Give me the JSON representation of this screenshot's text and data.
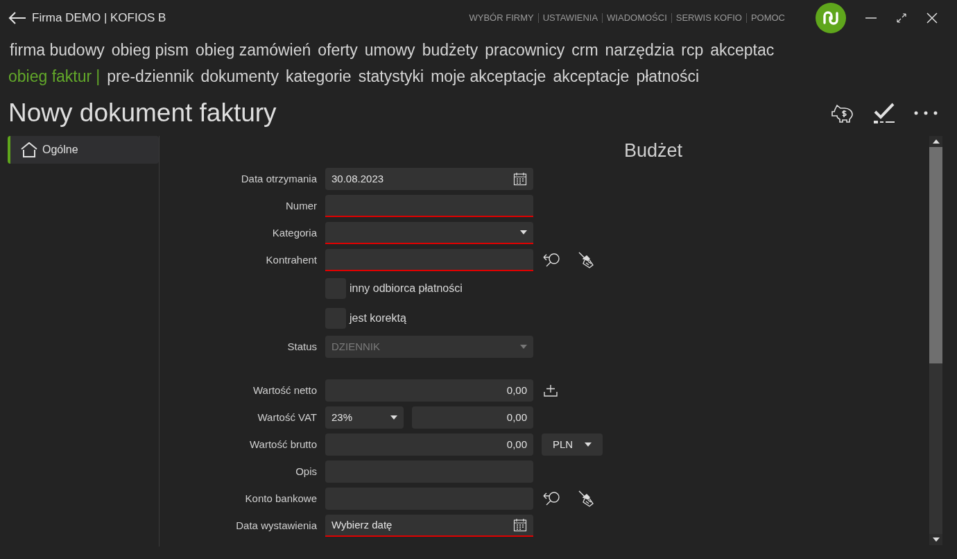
{
  "window": {
    "title": "Firma DEMO | KOFIOS B"
  },
  "top_links": [
    "WYBÓR FIRMY",
    "USTAWIENIA",
    "WIADOMOŚCI",
    "SERWIS KOFIO",
    "POMOC"
  ],
  "main_menu": [
    {
      "label": "firma budowy",
      "selected": false
    },
    {
      "label": "obieg pism",
      "selected": false
    },
    {
      "label": "obieg zamówień",
      "selected": false
    },
    {
      "label": "oferty",
      "selected": false
    },
    {
      "label": "umowy",
      "selected": false
    },
    {
      "label": "budżety",
      "selected": false
    },
    {
      "label": "pracownicy",
      "selected": false
    },
    {
      "label": "crm",
      "selected": false
    },
    {
      "label": "narzędzia",
      "selected": false
    },
    {
      "label": "rcp",
      "selected": false
    },
    {
      "label": "akceptac",
      "selected": false
    }
  ],
  "sub_menu": {
    "separator": "|",
    "items": [
      {
        "label": "obieg faktur",
        "selected": true
      },
      {
        "label": "pre-dziennik",
        "selected": false
      },
      {
        "label": "dokumenty",
        "selected": false
      },
      {
        "label": "kategorie",
        "selected": false
      },
      {
        "label": "statystyki",
        "selected": false
      },
      {
        "label": "moje akceptacje",
        "selected": false
      },
      {
        "label": "akceptacje",
        "selected": false
      },
      {
        "label": "płatności",
        "selected": false
      }
    ]
  },
  "page_title": "Nowy dokument faktury",
  "sidebar": {
    "items": [
      {
        "label": "Ogólne",
        "selected": true
      }
    ]
  },
  "budget_heading": "Budżet",
  "sections": [
    {
      "fields": [
        {
          "kind": "date",
          "label": "Data otrzymania",
          "value": "30.08.2023",
          "required": false
        },
        {
          "kind": "text",
          "label": "Numer",
          "required": true
        },
        {
          "kind": "select",
          "label": "Kategoria",
          "required": true
        },
        {
          "kind": "text",
          "label": "Kontrahent",
          "required": true,
          "tools": [
            {
              "kind": "lookup"
            },
            {
              "kind": "clear"
            }
          ]
        },
        {
          "kind": "checkbox",
          "label": "inny odbiorca płatności",
          "checked": false
        },
        {
          "kind": "checkbox",
          "label": "jest korektą",
          "checked": false
        },
        {
          "kind": "select",
          "label": "Status",
          "value": "DZIENNIK",
          "disabled": true
        }
      ]
    },
    {
      "fields": [
        {
          "kind": "amount",
          "label": "Wartość netto",
          "value": "0,00",
          "tools": [
            {
              "kind": "add"
            }
          ]
        },
        {
          "kind": "vat",
          "label": "Wartość VAT",
          "rate": "23%",
          "value": "0,00"
        },
        {
          "kind": "amount",
          "label": "Wartość brutto",
          "value": "0,00",
          "currency": "PLN"
        },
        {
          "kind": "text",
          "label": "Opis"
        },
        {
          "kind": "text",
          "label": "Konto bankowe",
          "tools": [
            {
              "kind": "lookup"
            },
            {
              "kind": "clear"
            }
          ]
        },
        {
          "kind": "date",
          "label": "Data wystawienia",
          "placeholder": "Wybierz datę",
          "required": true
        }
      ]
    }
  ]
}
